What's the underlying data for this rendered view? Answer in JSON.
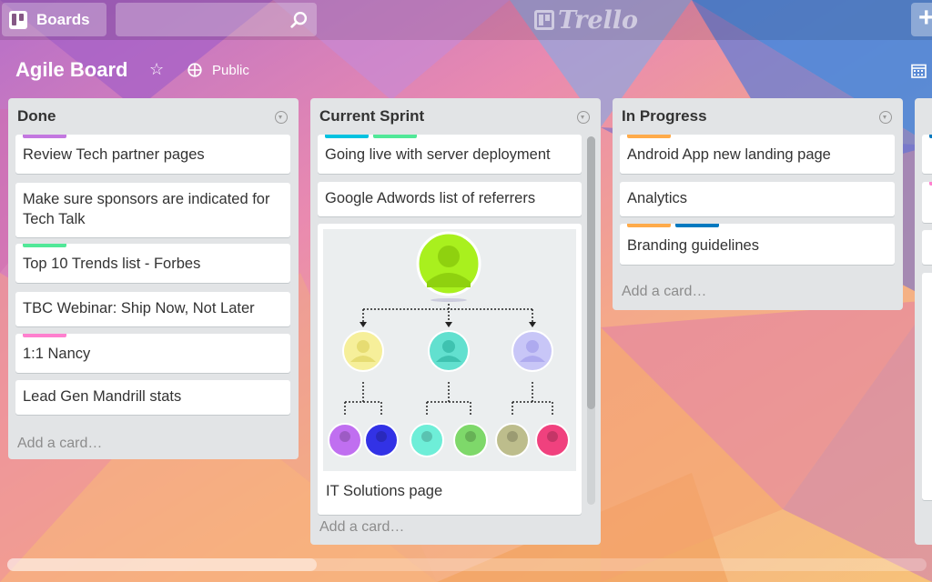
{
  "header": {
    "boards_label": "Boards",
    "search_placeholder": "",
    "logo_text": "Trello",
    "add_label": "+"
  },
  "board": {
    "title": "Agile Board",
    "visibility": "Public"
  },
  "colors": {
    "label_purple": "#c377e0",
    "label_green": "#51e898",
    "label_pink": "#ff80ce",
    "label_cyan": "#00c2e0",
    "label_orange": "#ffab4a",
    "label_blue": "#0079bf"
  },
  "lists": [
    {
      "name": "Done",
      "add_card": "Add a card…",
      "cards": [
        {
          "title": "Review Tech partner pages",
          "labels": [
            "purple"
          ]
        },
        {
          "title": "Make sure sponsors are indicated for Tech Talk",
          "labels": []
        },
        {
          "title": "Top 10 Trends list - Forbes",
          "labels": [
            "green"
          ]
        },
        {
          "title": "TBC Webinar: Ship Now, Not Later",
          "labels": []
        },
        {
          "title": "1:1 Nancy",
          "labels": [
            "pink"
          ]
        },
        {
          "title": "Lead Gen Mandrill stats",
          "labels": []
        }
      ]
    },
    {
      "name": "Current Sprint",
      "add_card": "Add a card…",
      "cards": [
        {
          "title": "Going live with server deployment",
          "labels": [
            "cyan",
            "green"
          ]
        },
        {
          "title": "Google Adwords list of referrers",
          "labels": []
        },
        {
          "title": "IT Solutions page",
          "labels": [],
          "has_cover_image": true,
          "cover": "org-chart"
        }
      ]
    },
    {
      "name": "In Progress",
      "add_card": "Add a card…",
      "cards": [
        {
          "title": "Android App new landing page",
          "labels": [
            "orange"
          ]
        },
        {
          "title": "Analytics",
          "labels": []
        },
        {
          "title": "Branding guidelines",
          "labels": [
            "orange",
            "blue"
          ]
        }
      ]
    }
  ]
}
